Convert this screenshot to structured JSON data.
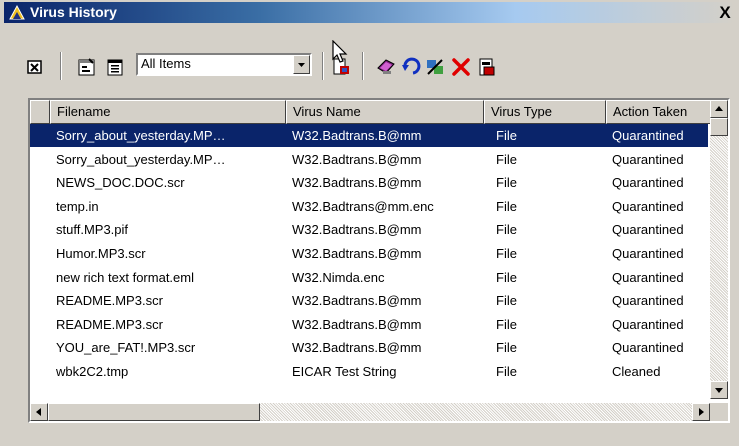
{
  "window": {
    "title": "Virus History",
    "close_label": "X"
  },
  "toolbar": {
    "filter_value": "All Items",
    "icons": [
      "clear-history-icon",
      "properties-icon",
      "view-icon",
      "load-icon",
      "help-icon",
      "undo-icon",
      "repair-icon",
      "delete-icon",
      "restore-icon"
    ]
  },
  "table": {
    "columns": [
      "Filename",
      "Virus Name",
      "Virus Type",
      "Action Taken"
    ],
    "rows": [
      {
        "filename": "Sorry_about_yesterday.MP…",
        "virus": "W32.Badtrans.B@mm",
        "type": "File",
        "action": "Quarantined",
        "selected": true
      },
      {
        "filename": "Sorry_about_yesterday.MP…",
        "virus": "W32.Badtrans.B@mm",
        "type": "File",
        "action": "Quarantined"
      },
      {
        "filename": "NEWS_DOC.DOC.scr",
        "virus": "W32.Badtrans.B@mm",
        "type": "File",
        "action": "Quarantined"
      },
      {
        "filename": "temp.in",
        "virus": "W32.Badtrans@mm.enc",
        "type": "File",
        "action": "Quarantined"
      },
      {
        "filename": "stuff.MP3.pif",
        "virus": "W32.Badtrans.B@mm",
        "type": "File",
        "action": "Quarantined"
      },
      {
        "filename": "Humor.MP3.scr",
        "virus": "W32.Badtrans.B@mm",
        "type": "File",
        "action": "Quarantined"
      },
      {
        "filename": "new rich text format.eml",
        "virus": "W32.Nimda.enc",
        "type": "File",
        "action": "Quarantined"
      },
      {
        "filename": "README.MP3.scr",
        "virus": "W32.Badtrans.B@mm",
        "type": "File",
        "action": "Quarantined"
      },
      {
        "filename": "README.MP3.scr",
        "virus": "W32.Badtrans.B@mm",
        "type": "File",
        "action": "Quarantined"
      },
      {
        "filename": "YOU_are_FAT!.MP3.scr",
        "virus": "W32.Badtrans.B@mm",
        "type": "File",
        "action": "Quarantined"
      },
      {
        "filename": "wbk2C2.tmp",
        "virus": "EICAR Test String",
        "type": "File",
        "action": "Cleaned"
      }
    ]
  },
  "colors": {
    "selection": "#0a246a",
    "face": "#d4d0c8",
    "title_start": "#0a246a",
    "delete_red": "#e00000"
  }
}
